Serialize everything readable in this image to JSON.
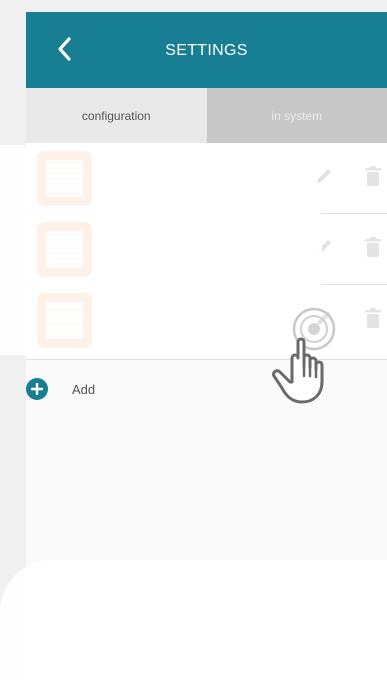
{
  "header": {
    "title": "SETTINGS",
    "back_icon": "chevron-left-icon"
  },
  "tabs": [
    {
      "label": "configuration",
      "active": true
    },
    {
      "label": "in system",
      "active": false
    }
  ],
  "products": [
    {
      "name": "",
      "icon": "roller-shutter-icon",
      "edit_icon": "pencil-icon",
      "delete_icon": "trash-icon"
    },
    {
      "name": "",
      "icon": "roller-shutter-icon",
      "edit_icon": "pencil-icon",
      "delete_icon": "trash-icon"
    },
    {
      "name": "",
      "icon": "roller-shutter-icon",
      "edit_icon": "pencil-icon",
      "delete_icon": "trash-icon"
    }
  ],
  "add": {
    "label": "Add",
    "icon": "plus-circle-icon"
  },
  "colors": {
    "header": "#177e93",
    "product": "#f37f1a",
    "accent": "#177e93"
  },
  "gesture": {
    "icon": "tap-hand-icon"
  }
}
